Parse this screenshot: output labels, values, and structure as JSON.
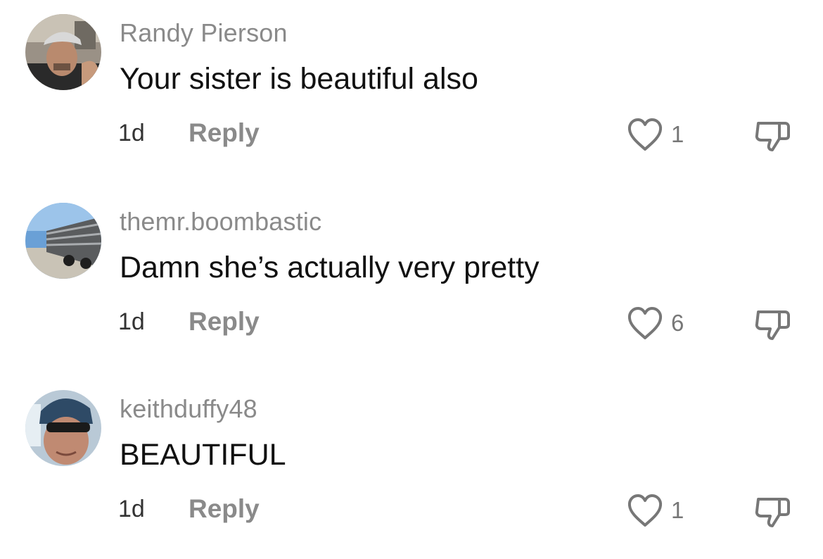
{
  "comments": [
    {
      "username": "Randy Pierson",
      "text": "Your sister is beautiful also",
      "time": "1d",
      "reply_label": "Reply",
      "likes": "1"
    },
    {
      "username": "themr.boombastic",
      "text": "Damn she’s actually very pretty",
      "time": "1d",
      "reply_label": "Reply",
      "likes": "6"
    },
    {
      "username": "keithduffy48",
      "text": "BEAUTIFUL",
      "time": "1d",
      "reply_label": "Reply",
      "likes": "1"
    }
  ],
  "icons": {
    "like": "heart-outline-icon",
    "dislike": "thumbs-down-outline-icon"
  },
  "colors": {
    "username": "#8a8a8a",
    "comment_text": "#111111",
    "reply": "#8a8a8a",
    "icon": "#777777"
  }
}
